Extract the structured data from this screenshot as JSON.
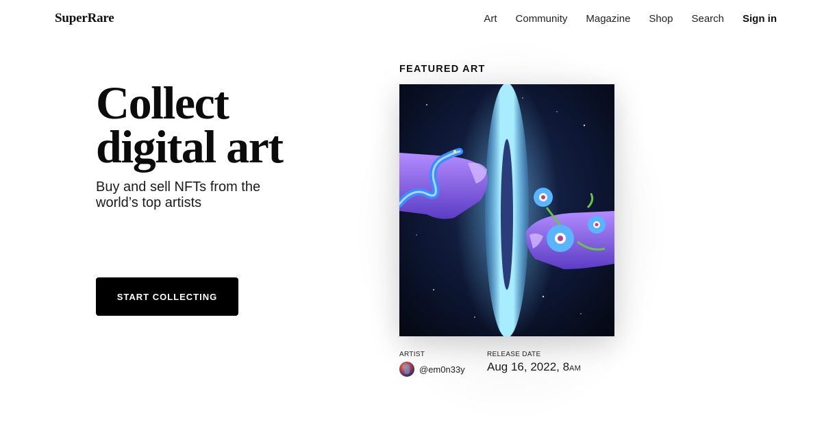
{
  "brand": {
    "logo": "SuperRare"
  },
  "nav": {
    "items": [
      "Art",
      "Community",
      "Magazine",
      "Shop",
      "Search"
    ],
    "sign_in": "Sign in"
  },
  "hero": {
    "title_line1": "Collect",
    "title_line2": "digital art",
    "subtitle": "Buy and sell NFTs from the world’s top artists",
    "cta": "START COLLECTING"
  },
  "featured": {
    "heading": "FEATURED ART",
    "artist_label": "ARTIST",
    "artist_handle": "@em0n33y",
    "release_label": "RELEASE DATE",
    "release_date": "Aug 16, 2022, 8",
    "release_ampm": "AM"
  },
  "colors": {
    "accent": "#000000",
    "background": "#ffffff",
    "portal": "#9fe6ff"
  },
  "icons": {
    "artist_avatar": "avatar-image"
  }
}
